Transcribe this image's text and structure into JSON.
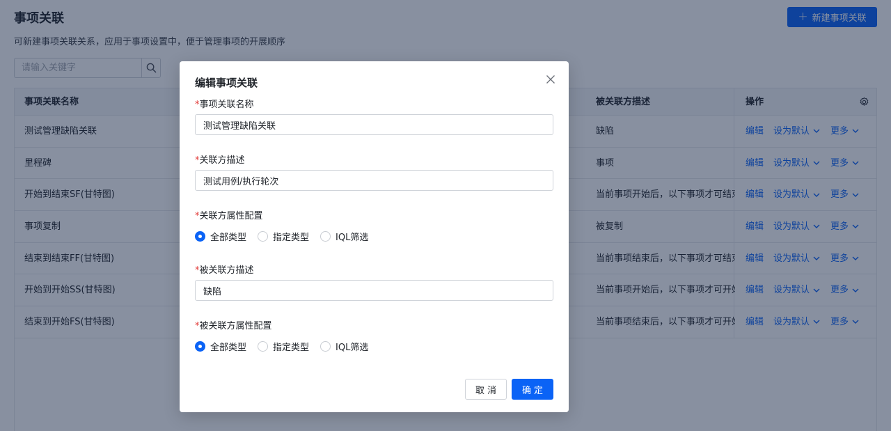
{
  "page": {
    "title": "事项关联",
    "description": "可新建事项关联关系，应用于事项设置中，便于管理事项的开展顺序",
    "new_button": "新建事项关联",
    "search_placeholder": "请输入关键字"
  },
  "table": {
    "headers": {
      "name": "事项关联名称",
      "target_desc": "被关联方描述",
      "ops": "操作"
    },
    "rows": [
      {
        "name": "测试管理缺陷关联",
        "target_desc": "缺陷"
      },
      {
        "name": "里程碑",
        "target_desc": "事项"
      },
      {
        "name": "开始到结束SF(甘特图)",
        "target_desc": "当前事项开始后，以下事项才可结束"
      },
      {
        "name": "事项复制",
        "target_desc": "被复制"
      },
      {
        "name": "结束到结束FF(甘特图)",
        "target_desc": "当前事项结束后，以下事项才可结束"
      },
      {
        "name": "开始到开始SS(甘特图)",
        "target_desc": "当前事项开始后，以下事项才可开始"
      },
      {
        "name": "结束到开始FS(甘特图)",
        "target_desc": "当前事项结束后，以下事项才可开始"
      }
    ],
    "ops": {
      "edit": "编辑",
      "set_default": "设为默认",
      "more": "更多"
    }
  },
  "modal": {
    "title": "编辑事项关联",
    "required_mark": "*",
    "name_label": "事项关联名称",
    "name_value": "测试管理缺陷关联",
    "source_desc_label": "关联方描述",
    "source_desc_value": "测试用例/执行轮次",
    "source_config_label": "关联方属性配置",
    "target_desc_label": "被关联方描述",
    "target_desc_value": "缺陷",
    "target_config_label": "被关联方属性配置",
    "radio_options": [
      "全部类型",
      "指定类型",
      "IQL筛选"
    ],
    "source_selected": "全部类型",
    "target_selected": "全部类型",
    "cancel": "取消",
    "ok": "确定"
  },
  "colors": {
    "primary": "#0b63f6",
    "required": "#e23c39",
    "overlay": "rgba(18,33,66,0.5)"
  }
}
